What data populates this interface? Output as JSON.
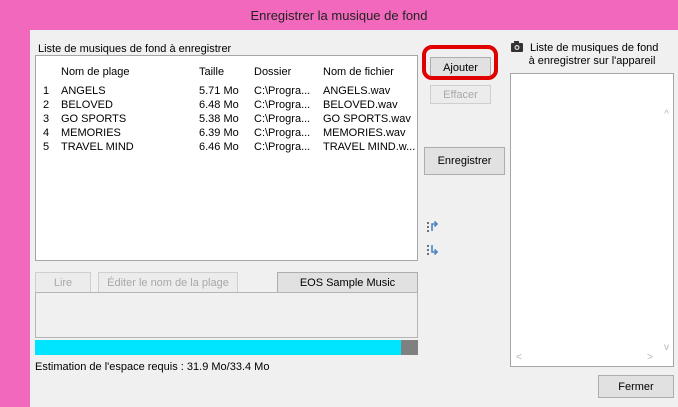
{
  "window": {
    "title": "Enregistrer la musique de fond"
  },
  "left": {
    "list_label": "Liste de musiques de fond à enregistrer",
    "columns": {
      "name": "Nom de plage",
      "size": "Taille",
      "folder": "Dossier",
      "file": "Nom de fichier"
    },
    "rows": [
      {
        "num": "1",
        "name": "ANGELS",
        "size": "5.71 Mo",
        "folder": "C:\\Progra...",
        "file": "ANGELS.wav"
      },
      {
        "num": "2",
        "name": "BELOVED",
        "size": "6.48 Mo",
        "folder": "C:\\Progra...",
        "file": "BELOVED.wav"
      },
      {
        "num": "3",
        "name": "GO SPORTS",
        "size": "5.38 Mo",
        "folder": "C:\\Progra...",
        "file": "GO SPORTS.wav"
      },
      {
        "num": "4",
        "name": "MEMORIES",
        "size": "6.39 Mo",
        "folder": "C:\\Progra...",
        "file": "MEMORIES.wav"
      },
      {
        "num": "5",
        "name": "TRAVEL MIND",
        "size": "6.46 Mo",
        "folder": "C:\\Progra...",
        "file": "TRAVEL MIND.w..."
      }
    ],
    "play_label": "Lire",
    "edit_label": "Éditer le nom de la plage",
    "sample_label": "EOS Sample Music",
    "estimate": "Estimation de l'espace requis : 31.9 Mo/33.4 Mo",
    "progress_fraction": 0.955
  },
  "middle": {
    "add_label": "Ajouter",
    "delete_label": "Effacer",
    "register_label": "Enregistrer"
  },
  "right": {
    "label_line1": "Liste de musiques de fond",
    "label_line2": "à enregistrer sur l'appareil"
  },
  "close_label": "Fermer",
  "colors": {
    "title_bar": "#f268bd",
    "progress": "#00e5ff",
    "highlight": "#e00000"
  },
  "icons": {
    "camera": "camera-icon",
    "move_up": "move-up-icon",
    "move_down": "move-down-icon"
  }
}
